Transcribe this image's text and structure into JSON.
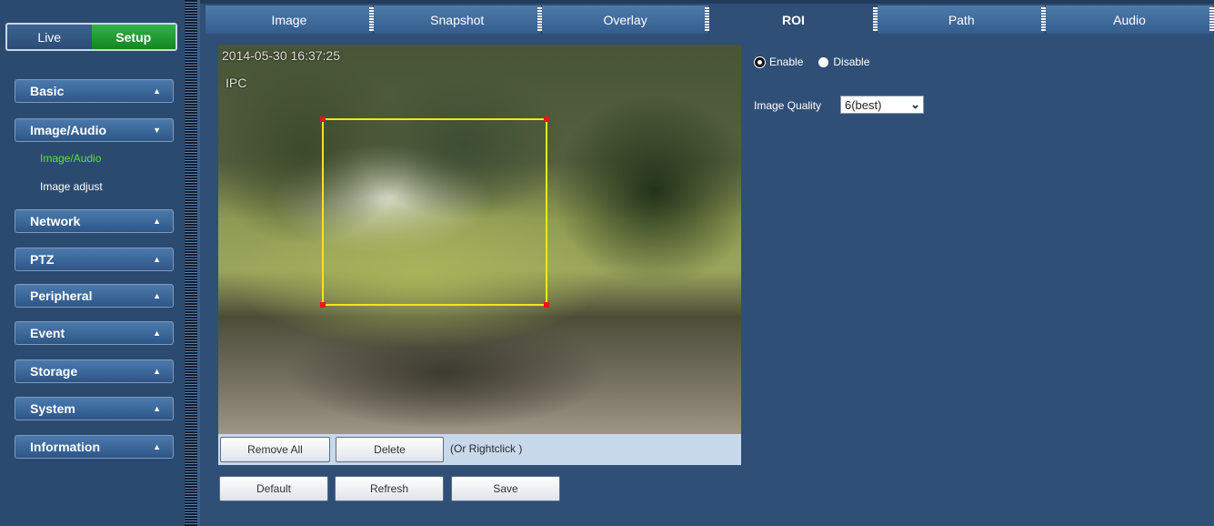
{
  "sidebar": {
    "mode": {
      "live_label": "Live",
      "setup_label": "Setup"
    },
    "menu": [
      {
        "label": "Basic",
        "caret": "▲"
      },
      {
        "label": "Image/Audio",
        "caret": "▼"
      },
      {
        "label": "Network",
        "caret": "▲"
      },
      {
        "label": "PTZ",
        "caret": "▲"
      },
      {
        "label": "Peripheral",
        "caret": "▲"
      },
      {
        "label": "Event",
        "caret": "▲"
      },
      {
        "label": "Storage",
        "caret": "▲"
      },
      {
        "label": "System",
        "caret": "▲"
      },
      {
        "label": "Information",
        "caret": "▲"
      }
    ],
    "submenu": [
      {
        "label": "Image/Audio",
        "state": "active"
      },
      {
        "label": "Image adjust",
        "state": "normal"
      }
    ]
  },
  "tabs": [
    {
      "label": "Image"
    },
    {
      "label": "Snapshot"
    },
    {
      "label": "Overlay"
    },
    {
      "label": "ROI",
      "active": true
    },
    {
      "label": "Path"
    },
    {
      "label": "Audio"
    }
  ],
  "video": {
    "timestamp": "2014-05-30 16:37:25",
    "channel_name": "IPC"
  },
  "roi_actions": {
    "remove_all_label": "Remove All",
    "delete_label": "Delete",
    "hint": "(Or Rightclick )"
  },
  "footer_buttons": {
    "default_label": "Default",
    "refresh_label": "Refresh",
    "save_label": "Save"
  },
  "settings": {
    "enable_label": "Enable",
    "disable_label": "Disable",
    "selected": "Enable",
    "image_quality_label": "Image Quality",
    "image_quality_value": "6(best)"
  },
  "colors": {
    "accent_green": "#35b14a",
    "active_submenu": "#5ce03a",
    "roi_border": "#f2e51a",
    "roi_handle": "#e0181b"
  }
}
